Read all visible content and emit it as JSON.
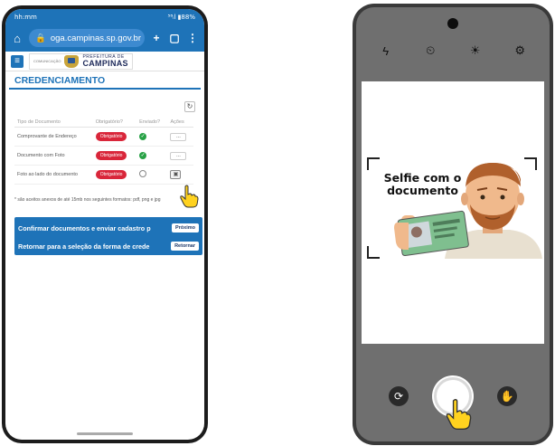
{
  "left_phone": {
    "status": {
      "time": "hh:mm",
      "indicators": "⁵⁸ᵢl ▮88%"
    },
    "browser": {
      "url": "oga.campinas.sp.gov.br",
      "home_icon": "home-icon",
      "lock_icon": "lock-icon"
    },
    "site": {
      "logo_small": "COMUNICAÇÃO",
      "logo_line1": "PREFEITURA DE",
      "logo_line2": "CAMPINAS"
    },
    "page_title": "CREDENCIAMENTO",
    "table": {
      "headers": [
        "Tipo de Documento",
        "Obrigatório?",
        "Enviado?",
        "Ações"
      ],
      "rows": [
        {
          "doc": "Comprovante de Endereço",
          "required": "Obrigatório",
          "sent": "ok",
          "action": "..."
        },
        {
          "doc": "Documento com Foto",
          "required": "Obrigatório",
          "sent": "ok",
          "action": "..."
        },
        {
          "doc": "Foto ao lado do documento",
          "required": "Obrigatório",
          "sent": "pending",
          "action": "camera"
        }
      ]
    },
    "note": "* são aceitos anexos de até 15mb nos seguintes formatos: pdf, png e jpg",
    "actions": [
      {
        "text": "Confirmar documentos e enviar cadastro p",
        "button": "Próximo"
      },
      {
        "text": "Retornar para a seleção da forma de crede",
        "button": "Retornar"
      }
    ]
  },
  "right_phone": {
    "top_icons": [
      "flash-icon",
      "timer-icon",
      "brightness-icon",
      "settings-icon"
    ],
    "selfie_text": "Selfie com o documento",
    "bottom_icons": [
      "switch-camera-icon",
      "shutter-button",
      "gallery-icon"
    ]
  },
  "colors": {
    "brand_blue": "#1e73b8",
    "required_red": "#d9263a",
    "ok_green": "#27a145"
  }
}
